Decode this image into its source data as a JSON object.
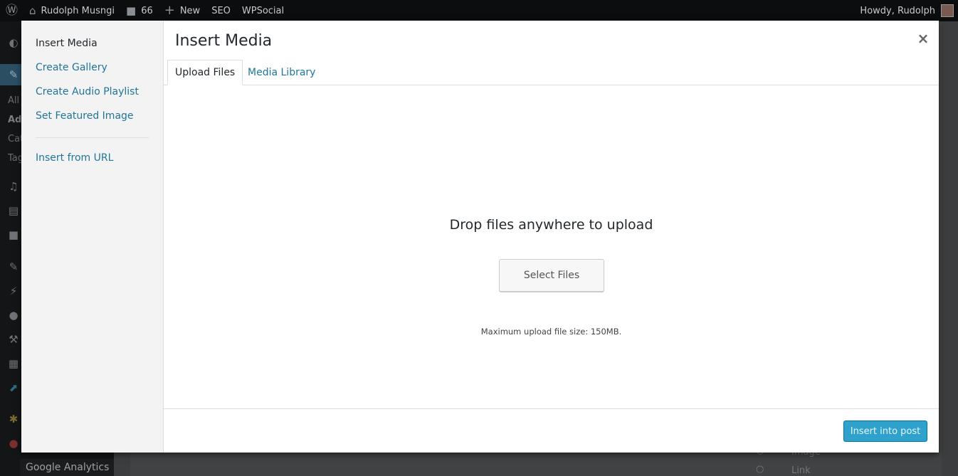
{
  "adminbar": {
    "site_name": "Rudolph Musngi",
    "comments_count": "66",
    "new_label": "New",
    "seo_label": "SEO",
    "wpsocial_label": "WPSocial",
    "greeting": "Howdy, Rudolph"
  },
  "background": {
    "sidebar_texts": [
      "All",
      "Ad",
      "Cat",
      "Tag"
    ],
    "sidebar_bottom_label": "Google Analytics",
    "right_items": [
      "Image",
      "Link"
    ]
  },
  "modal": {
    "menu": {
      "items": [
        "Insert Media",
        "Create Gallery",
        "Create Audio Playlist",
        "Set Featured Image"
      ],
      "insert_from_url": "Insert from URL"
    },
    "title": "Insert Media",
    "close_label": "×",
    "tabs": [
      "Upload Files",
      "Media Library"
    ],
    "upload": {
      "instructions": "Drop files anywhere to upload",
      "select_files_label": "Select Files",
      "max_size": "Maximum upload file size: 150MB."
    },
    "toolbar": {
      "insert_label": "Insert into post"
    }
  },
  "colors": {
    "accent": "#21759b",
    "primary_button": "#2ea2cc",
    "admin_bar": "#0c0d0e"
  }
}
